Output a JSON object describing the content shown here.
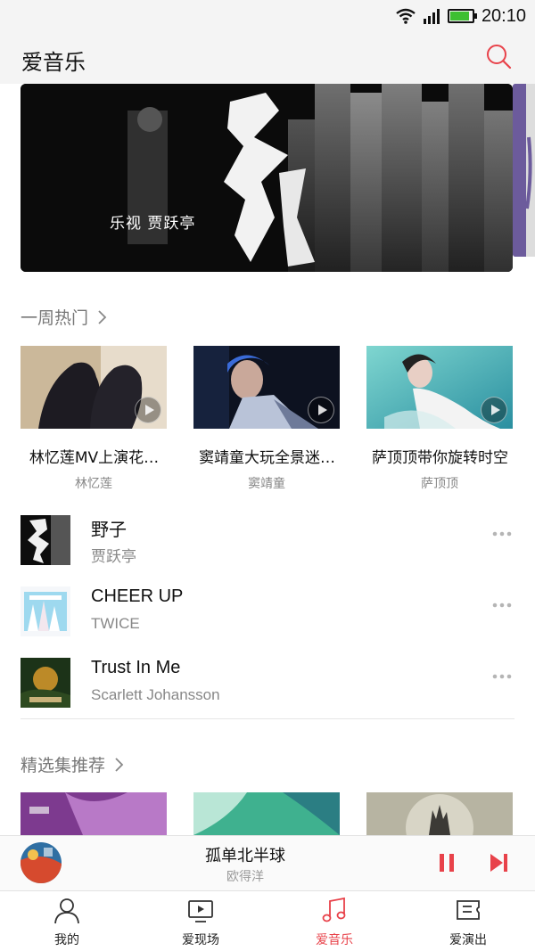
{
  "status_bar": {
    "time": "20:10"
  },
  "header": {
    "title": "爱音乐"
  },
  "banner": {
    "caption": "乐视 贾跃亭",
    "art_text": "野子"
  },
  "weekly_hot": {
    "title": "一周热门",
    "items": [
      {
        "title": "林忆莲MV上演花…",
        "artist": "林忆莲"
      },
      {
        "title": "窦靖童大玩全景迷…",
        "artist": "窦靖童"
      },
      {
        "title": "萨顶顶带你旋转时空",
        "artist": "萨顶顶"
      }
    ]
  },
  "songs": [
    {
      "title": "野子",
      "artist": "贾跃亭"
    },
    {
      "title": "CHEER UP",
      "artist": "TWICE"
    },
    {
      "title": "Trust In Me",
      "artist": "Scarlett Johansson"
    }
  ],
  "featured": {
    "title": "精选集推荐"
  },
  "now_playing": {
    "title": "孤单北半球",
    "artist": "欧得洋"
  },
  "tabs": [
    {
      "label": "我的",
      "icon": "person-icon"
    },
    {
      "label": "爱现场",
      "icon": "tv-icon"
    },
    {
      "label": "爱音乐",
      "icon": "music-note-icon",
      "active": true
    },
    {
      "label": "爱演出",
      "icon": "ticket-icon"
    }
  ],
  "colors": {
    "accent": "#e8424a",
    "battery": "#3dbf32"
  },
  "battery_level": 0.9
}
